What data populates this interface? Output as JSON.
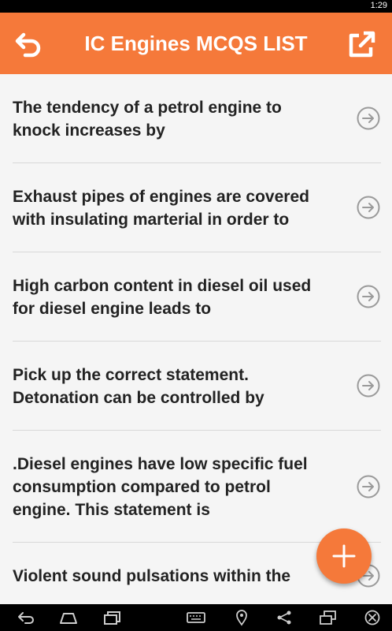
{
  "status": {
    "time": "1:29"
  },
  "appbar": {
    "title": "IC Engines MCQS LIST"
  },
  "questions": [
    {
      "text": "The tendency of a petrol engine to knock increases by"
    },
    {
      "text": "Exhaust pipes of engines are covered with insulating marterial in order to"
    },
    {
      "text": "High carbon content in diesel oil used for diesel engine leads to"
    },
    {
      "text": "Pick up the correct statement. Detonation can be controlled by"
    },
    {
      "text": ".Diesel engines have low specific fuel consumption compared to petrol engine. This statement is"
    },
    {
      "text": "Violent sound pulsations within the"
    }
  ],
  "icons": {
    "back": "undo-arrow-icon",
    "share": "external-link-icon",
    "item_arrow": "circle-arrow-right-icon",
    "fab": "plus-icon"
  },
  "colors": {
    "accent": "#f5793a",
    "background": "#f5f5f5",
    "text": "#222222"
  }
}
